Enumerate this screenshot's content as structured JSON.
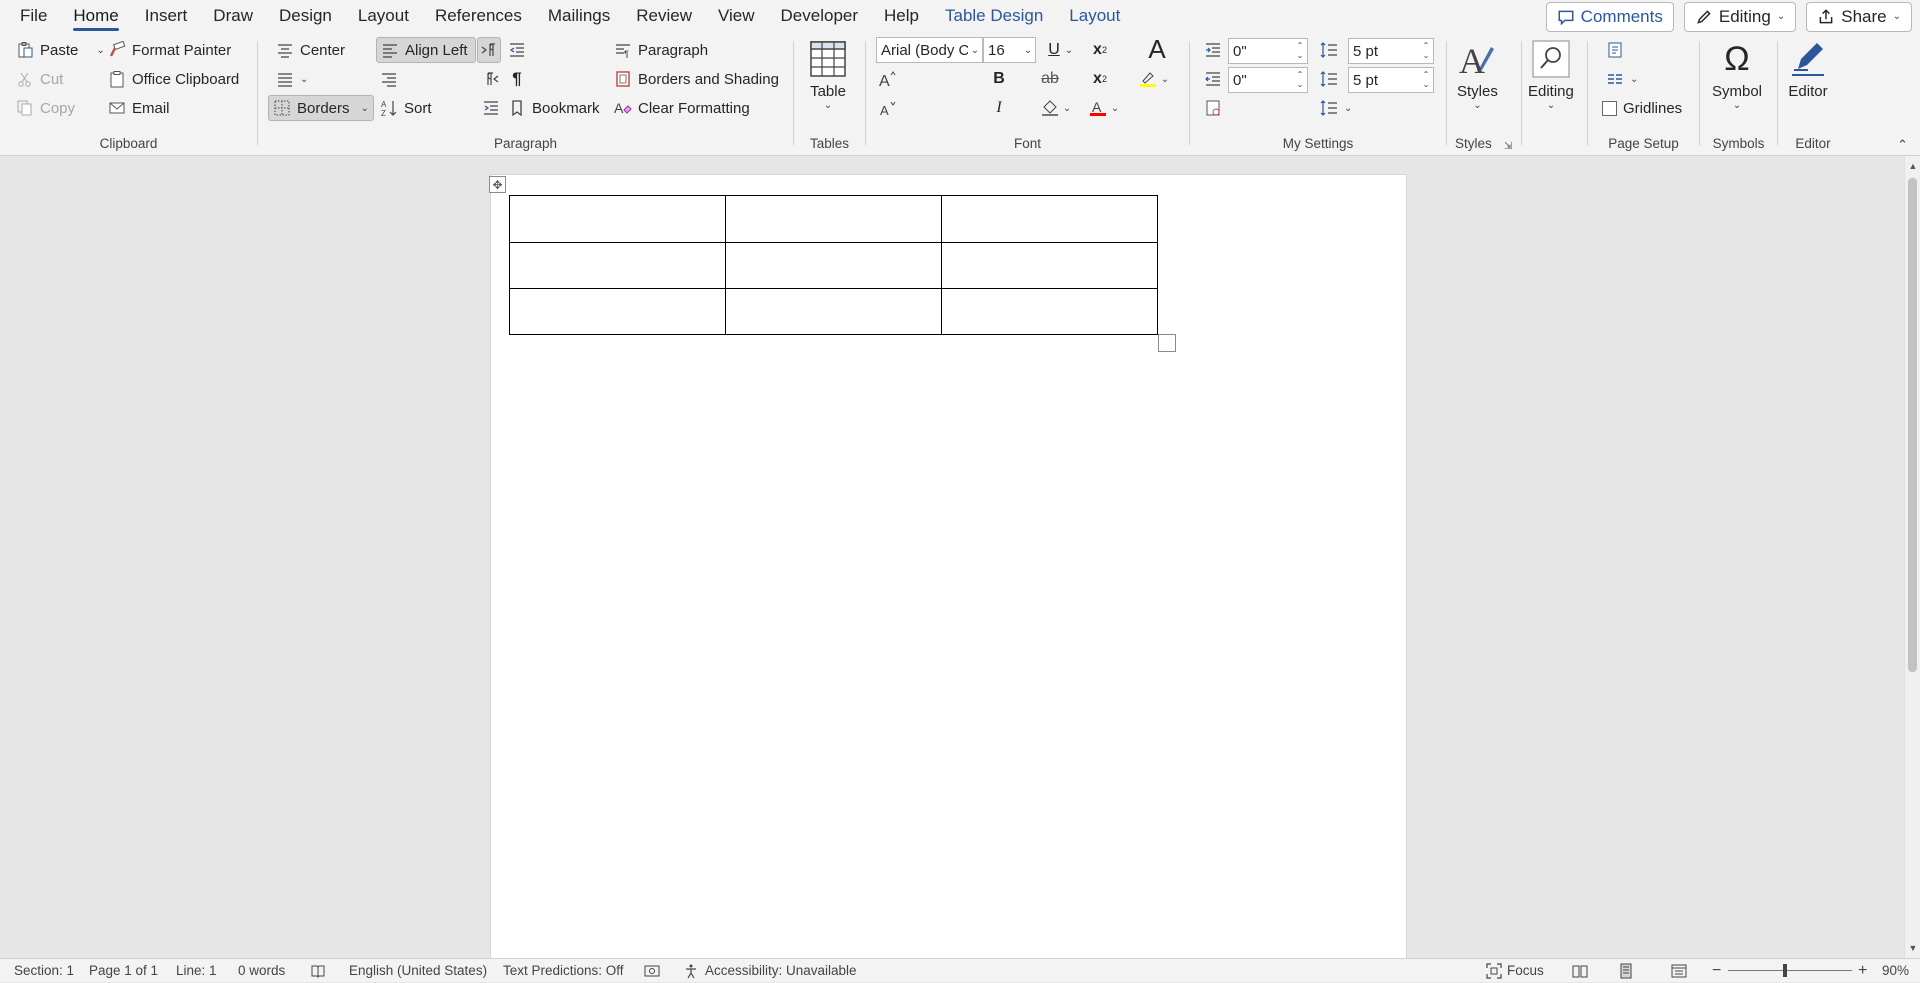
{
  "menu": {
    "tabs": [
      {
        "label": "File"
      },
      {
        "label": "Home"
      },
      {
        "label": "Insert"
      },
      {
        "label": "Draw"
      },
      {
        "label": "Design"
      },
      {
        "label": "Layout"
      },
      {
        "label": "References"
      },
      {
        "label": "Mailings"
      },
      {
        "label": "Review"
      },
      {
        "label": "View"
      },
      {
        "label": "Developer"
      },
      {
        "label": "Help"
      },
      {
        "label": "Table Design"
      },
      {
        "label": "Layout"
      }
    ],
    "active_tab": "Home",
    "comments_label": "Comments",
    "editing_label": "Editing",
    "share_label": "Share"
  },
  "ribbon": {
    "clipboard": {
      "label": "Clipboard",
      "paste": "Paste",
      "cut": "Cut",
      "copy": "Copy",
      "format_painter": "Format Painter",
      "office_clipboard": "Office Clipboard",
      "email": "Email"
    },
    "paragraph": {
      "label": "Paragraph",
      "center": "Center",
      "align_left": "Align Left",
      "borders": "Borders",
      "sort": "Sort",
      "paragraph": "Paragraph",
      "borders_and_shading": "Borders and Shading",
      "bookmark": "Bookmark",
      "clear_formatting": "Clear Formatting"
    },
    "tables": {
      "label": "Tables",
      "table": "Table"
    },
    "font": {
      "label": "Font",
      "font_name": "Arial (Body C",
      "font_size": "16",
      "bold": "B",
      "italic": "I",
      "underline": "U",
      "strikethrough": "ab",
      "superscript": "x",
      "subscript": "x",
      "clear_a": "A",
      "highlight_color": "#ffff00",
      "font_color": "#ff0000"
    },
    "my_settings": {
      "label": "My Settings",
      "indent_left": "0\"",
      "indent_right": "0\"",
      "spacing_before": "5 pt",
      "spacing_after": "5 pt"
    },
    "styles": {
      "label": "Styles",
      "styles": "Styles"
    },
    "editing": {
      "label": "Editing"
    },
    "page_setup": {
      "label": "Page Setup",
      "gridlines": "Gridlines"
    },
    "symbols": {
      "label": "Symbols",
      "symbol": "Symbol"
    },
    "editor": {
      "label": "Editor",
      "editor": "Editor"
    }
  },
  "document": {
    "table": {
      "rows": [
        [
          "",
          "",
          ""
        ],
        [
          "",
          "",
          ""
        ],
        [
          "",
          "",
          ""
        ]
      ]
    }
  },
  "status": {
    "section": "Section: 1",
    "page": "Page 1 of 1",
    "line": "Line: 1",
    "words": "0 words",
    "language": "English (United States)",
    "text_predictions": "Text Predictions: Off",
    "accessibility": "Accessibility: Unavailable",
    "focus": "Focus",
    "zoom_pct": "90%",
    "zoom_level": 90
  },
  "colors": {
    "accent": "#2b579a",
    "ribbon_bg": "#f3f3f3",
    "canvas_bg": "#e6e6e6"
  }
}
